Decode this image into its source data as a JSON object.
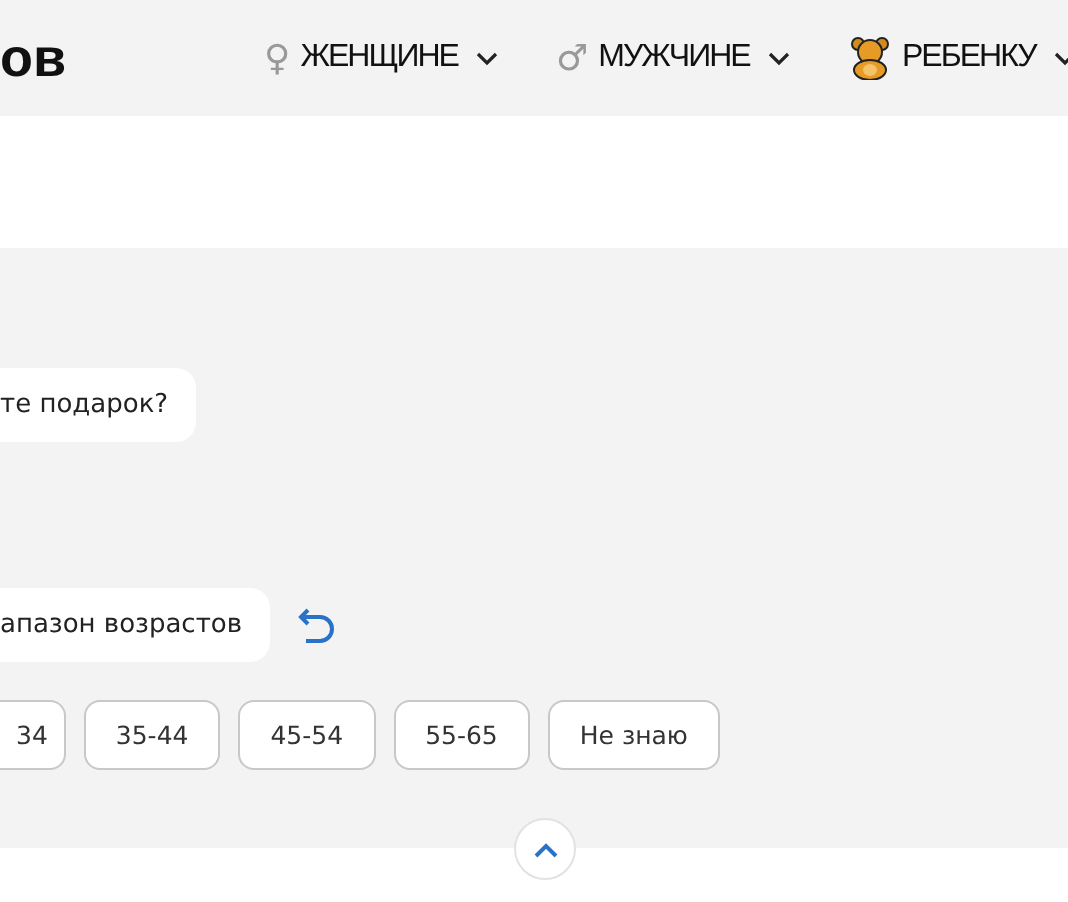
{
  "header": {
    "logo": "ов",
    "nav": [
      {
        "kind": "female",
        "symbol": "♀",
        "label": "ЖЕНЩИНЕ"
      },
      {
        "kind": "male",
        "symbol": "♂",
        "label": "МУЖЧИНЕ"
      },
      {
        "kind": "child",
        "label": "РЕБЕНКУ"
      }
    ]
  },
  "chat": {
    "messages": [
      "те подарок?",
      "апазон возрастов"
    ],
    "age_options": [
      {
        "label": "34",
        "selected": false
      },
      {
        "label": "35-44",
        "selected": false
      },
      {
        "label": "45-54",
        "selected": false
      },
      {
        "label": "55-65",
        "selected": false
      },
      {
        "label": "Не знаю",
        "selected": false
      }
    ]
  }
}
